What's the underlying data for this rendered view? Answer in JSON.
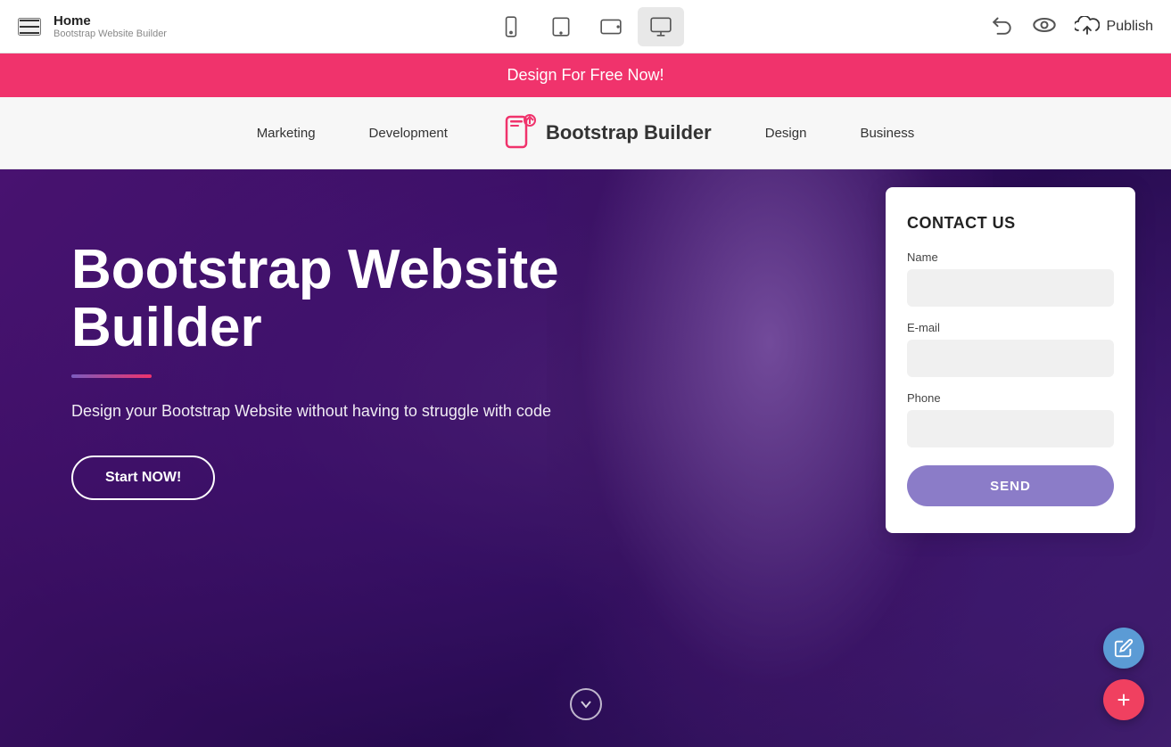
{
  "toolbar": {
    "hamburger_label": "menu",
    "main_title": "Home",
    "sub_title": "Bootstrap Website Builder",
    "devices": [
      {
        "id": "mobile",
        "label": "mobile"
      },
      {
        "id": "tablet",
        "label": "tablet"
      },
      {
        "id": "tablet-landscape",
        "label": "tablet landscape"
      },
      {
        "id": "desktop",
        "label": "desktop"
      }
    ],
    "undo_label": "undo",
    "preview_label": "preview",
    "publish_label": "Publish"
  },
  "promo": {
    "text": "Design For Free Now!"
  },
  "sitenav": {
    "items": [
      {
        "id": "marketing",
        "label": "Marketing"
      },
      {
        "id": "development",
        "label": "Development"
      },
      {
        "id": "design",
        "label": "Design"
      },
      {
        "id": "business",
        "label": "Business"
      }
    ],
    "logo_text": "Bootstrap Builder"
  },
  "hero": {
    "title": "Bootstrap Website Builder",
    "subtitle": "Design your Bootstrap Website without having to struggle with code",
    "cta_label": "Start NOW!",
    "scroll_label": "scroll down"
  },
  "contact_form": {
    "title": "CONTACT US",
    "name_label": "Name",
    "name_placeholder": "",
    "email_label": "E-mail",
    "email_placeholder": "",
    "phone_label": "Phone",
    "phone_placeholder": "",
    "send_label": "SEND"
  },
  "fab": {
    "pencil_label": "edit",
    "plus_label": "add"
  }
}
